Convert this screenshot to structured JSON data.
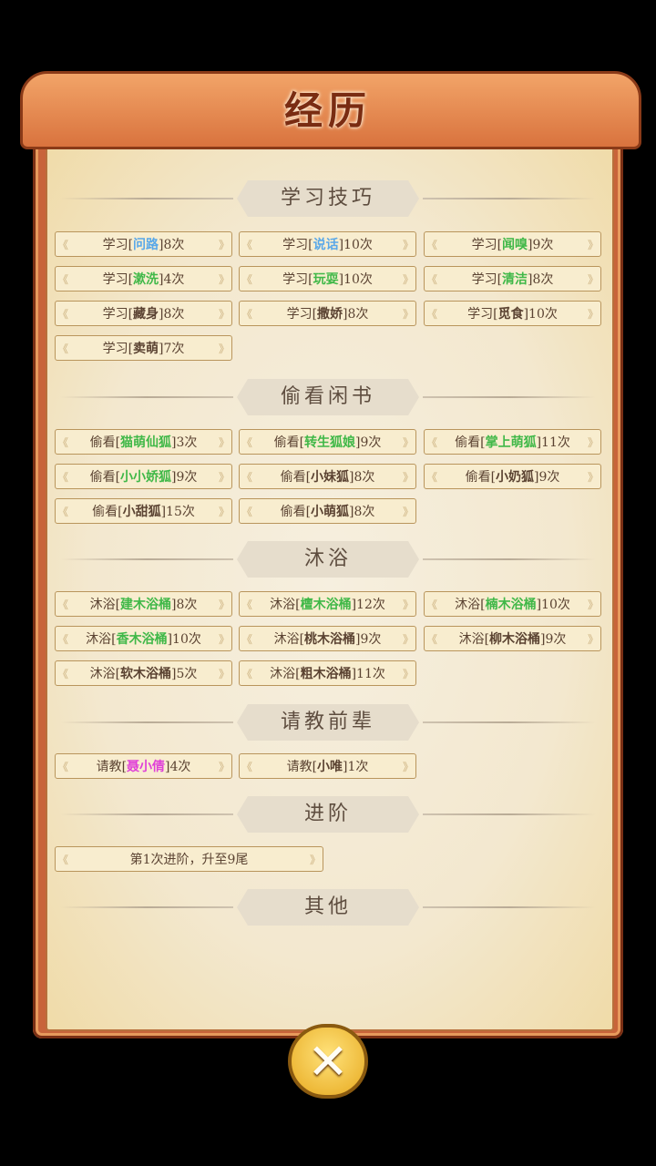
{
  "title": "经历",
  "sections": [
    {
      "name": "学习技巧",
      "items": [
        {
          "prefix": "学习[",
          "highlight": "问路",
          "suffix": "]8次",
          "color": "#5aa8e8"
        },
        {
          "prefix": "学习[",
          "highlight": "说话",
          "suffix": "]10次",
          "color": "#5aa8e8"
        },
        {
          "prefix": "学习[",
          "highlight": "闻嗅",
          "suffix": "]9次",
          "color": "#40b848"
        },
        {
          "prefix": "学习[",
          "highlight": "漱洗",
          "suffix": "]4次",
          "color": "#40b848"
        },
        {
          "prefix": "学习[",
          "highlight": "玩耍",
          "suffix": "]10次",
          "color": "#40b848"
        },
        {
          "prefix": "学习[",
          "highlight": "清洁",
          "suffix": "]8次",
          "color": "#40b848"
        },
        {
          "prefix": "学习[",
          "highlight": "藏身",
          "suffix": "]8次",
          "color": "#5b4332"
        },
        {
          "prefix": "学习[",
          "highlight": "撒娇",
          "suffix": "]8次",
          "color": "#5b4332"
        },
        {
          "prefix": "学习[",
          "highlight": "觅食",
          "suffix": "]10次",
          "color": "#5b4332"
        },
        {
          "prefix": "学习[",
          "highlight": "卖萌",
          "suffix": "]7次",
          "color": "#5b4332"
        }
      ]
    },
    {
      "name": "偷看闲书",
      "items": [
        {
          "prefix": "偷看[",
          "highlight": "猫萌仙狐",
          "suffix": "]3次",
          "color": "#40b848"
        },
        {
          "prefix": "偷看[",
          "highlight": "转生狐娘",
          "suffix": "]9次",
          "color": "#40b848"
        },
        {
          "prefix": "偷看[",
          "highlight": "掌上萌狐",
          "suffix": "]11次",
          "color": "#40b848"
        },
        {
          "prefix": "偷看[",
          "highlight": "小小娇狐",
          "suffix": "]9次",
          "color": "#40b848"
        },
        {
          "prefix": "偷看[",
          "highlight": "小妹狐",
          "suffix": "]8次",
          "color": "#5b4332"
        },
        {
          "prefix": "偷看[",
          "highlight": "小奶狐",
          "suffix": "]9次",
          "color": "#5b4332"
        },
        {
          "prefix": "偷看[",
          "highlight": "小甜狐",
          "suffix": "]15次",
          "color": "#5b4332"
        },
        {
          "prefix": "偷看[",
          "highlight": "小萌狐",
          "suffix": "]8次",
          "color": "#5b4332"
        }
      ]
    },
    {
      "name": "沐浴",
      "items": [
        {
          "prefix": "沐浴[",
          "highlight": "建木浴桶",
          "suffix": "]8次",
          "color": "#40b848"
        },
        {
          "prefix": "沐浴[",
          "highlight": "檀木浴桶",
          "suffix": "]12次",
          "color": "#40b848"
        },
        {
          "prefix": "沐浴[",
          "highlight": "楠木浴桶",
          "suffix": "]10次",
          "color": "#40b848"
        },
        {
          "prefix": "沐浴[",
          "highlight": "香木浴桶",
          "suffix": "]10次",
          "color": "#40b848"
        },
        {
          "prefix": "沐浴[",
          "highlight": "桃木浴桶",
          "suffix": "]9次",
          "color": "#5b4332"
        },
        {
          "prefix": "沐浴[",
          "highlight": "柳木浴桶",
          "suffix": "]9次",
          "color": "#5b4332"
        },
        {
          "prefix": "沐浴[",
          "highlight": "软木浴桶",
          "suffix": "]5次",
          "color": "#5b4332"
        },
        {
          "prefix": "沐浴[",
          "highlight": "粗木浴桶",
          "suffix": "]11次",
          "color": "#5b4332"
        }
      ]
    },
    {
      "name": "请教前辈",
      "items": [
        {
          "prefix": "请教[",
          "highlight": "聂小倩",
          "suffix": "]4次",
          "color": "#e040d8"
        },
        {
          "prefix": "请教[",
          "highlight": "小唯",
          "suffix": "]1次",
          "color": "#5b4332"
        }
      ]
    },
    {
      "name": "进阶",
      "items": [
        {
          "prefix": "第1次进阶，",
          "highlight": "",
          "suffix": "升至9尾",
          "color": "#5b4332"
        }
      ]
    },
    {
      "name": "其他",
      "items": []
    }
  ],
  "close_icon": "close-x-icon"
}
